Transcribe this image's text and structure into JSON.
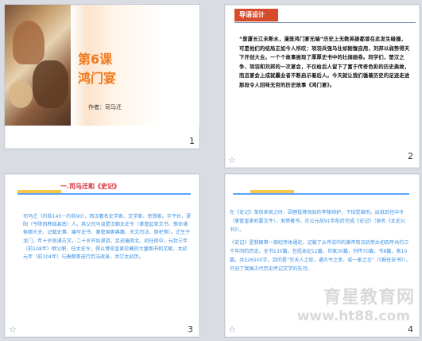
{
  "slides": [
    {
      "number": "1",
      "title_line1": "第6课",
      "title_line2": "鸿门宴",
      "author": "作者：司马迁"
    },
    {
      "number": "2",
      "heading": "导语设计",
      "body": "“废厦长江未断水，漫笼鸿门宴无端”历史上无数英雄都曾在此发生碰撞，可是他们的结局正如今人所叹：项羽兵强马壮却刚愎自用，刘邦以弱势得天下开创大业。一个个故事展现了厚厚史书中的壮阔画卷。同学们，楚汉之争、项羽和刘邦的一次宴会，不仅给后人留下了富于传奇色彩的历史典故，而且宴会上成就霸业者不断启示着后人。今天就让我们循着历史的足迹走进那段令人回味无穷的历史故事《鸿门宴》。",
      "fx_icon": "star-icon"
    },
    {
      "number": "3",
      "heading": "一.司马迁和《史记》",
      "body": "司马迁（约前145－约前90），西汉著名史学家、文学家、思想家。字子长，夏阳（今陕西韩城县南）人。其父司马谈是汉朝太史令（掌管起草文书、策命诸侯卿大夫、记载史事、编写史书、兼管国家典籍、天文历法、祭祀等）。迁生于龙门，年十岁则诵古文，二十岁开始漫游，足迹遍南北。初任郎中，元封三年（前108年）继父职，任太史令，得以博览皇家珍藏的大量图书和文献，太初元年（前104年）与唐都等进行历法改革，共订太初历。",
      "fx_icon": "star-icon"
    },
    {
      "number": "4",
      "paragraph1": "在《史记》草创未就之时，因替投降匈奴的李陵辩护，下狱受腐刑。出狱后任中令（掌管皇家机要文件），发愤著书，在公元前91年前后完成《史记》（原名《太史公书》）。",
      "paragraph2": "《史记》是我国第一部纪传体通史，记载了从传说中的黄帝到汉武帝太初四年共约三千年间的历史。全书130篇，包括本纪12篇，世家30篇，列传70篇，书8篇，表10篇，共526500字。目的是“究天人之际，通古今之变，成一家之言”（《报任安书》），开创了我国古代历史传记文学的先河。",
      "watermark": "育星教育网",
      "watermark_url": "www.ht88.com",
      "fx_icon": "star-icon"
    }
  ]
}
